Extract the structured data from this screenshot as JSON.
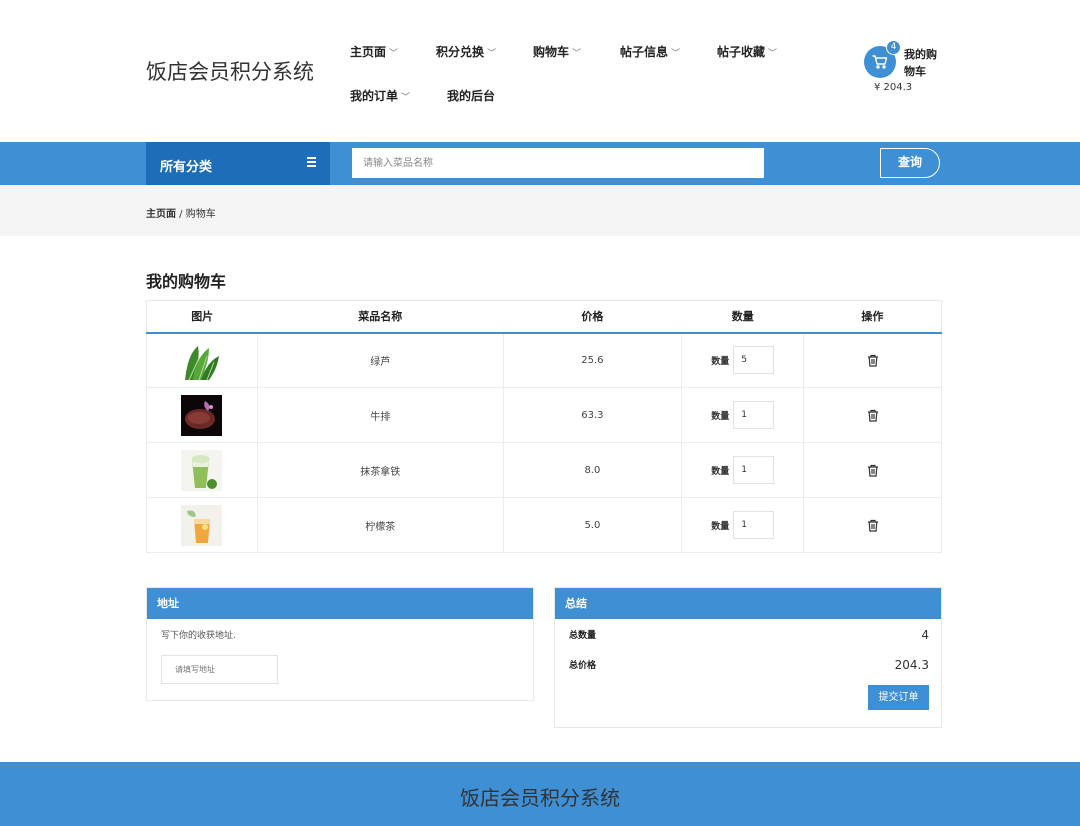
{
  "header": {
    "brand": "饭店会员积分系统",
    "nav": [
      {
        "label": "主页面",
        "has_dropdown": true
      },
      {
        "label": "积分兑换",
        "has_dropdown": true
      },
      {
        "label": "购物车",
        "has_dropdown": true
      },
      {
        "label": "帖子信息",
        "has_dropdown": true
      },
      {
        "label": "帖子收藏",
        "has_dropdown": true
      },
      {
        "label": "我的订单",
        "has_dropdown": true
      },
      {
        "label": "我的后台",
        "has_dropdown": false
      }
    ],
    "dropdown_glyph": "﹀",
    "cart": {
      "badge": "4",
      "label": "我的购物车",
      "total": "¥ 204.3",
      "icon": "cart-icon"
    }
  },
  "searchbar": {
    "category_label": "所有分类",
    "placeholder": "请输入菜品名称",
    "button_label": "查询"
  },
  "breadcrumb": {
    "home": "主页面",
    "separator": " / ",
    "current": "购物车"
  },
  "cart": {
    "title": "我的购物车",
    "columns": [
      "图片",
      "菜品名称",
      "价格",
      "数量",
      "操作"
    ],
    "qty_label": "数量",
    "items": [
      {
        "name": "绿芦",
        "price": "25.6",
        "qty": "5",
        "image": "green-vegetable-image"
      },
      {
        "name": "牛排",
        "price": "63.3",
        "qty": "1",
        "image": "steak-image"
      },
      {
        "name": "抹茶拿铁",
        "price": "8.0",
        "qty": "1",
        "image": "matcha-latte-image"
      },
      {
        "name": "柠檬茶",
        "price": "5.0",
        "qty": "1",
        "image": "lemon-tea-image"
      }
    ]
  },
  "address": {
    "title": "地址",
    "hint": "写下你的收获地址.",
    "placeholder": "请填写地址"
  },
  "summary": {
    "title": "总结",
    "total_qty_label": "总数量",
    "total_qty": "4",
    "total_price_label": "总价格",
    "total_price": "204.3",
    "submit_label": "提交订单"
  },
  "footer": {
    "brand": "饭店会员积分系统"
  },
  "colors": {
    "primary": "#3f8fd4",
    "primary_dark": "#1e6db8",
    "crumb_bg": "#f5f5f5"
  }
}
